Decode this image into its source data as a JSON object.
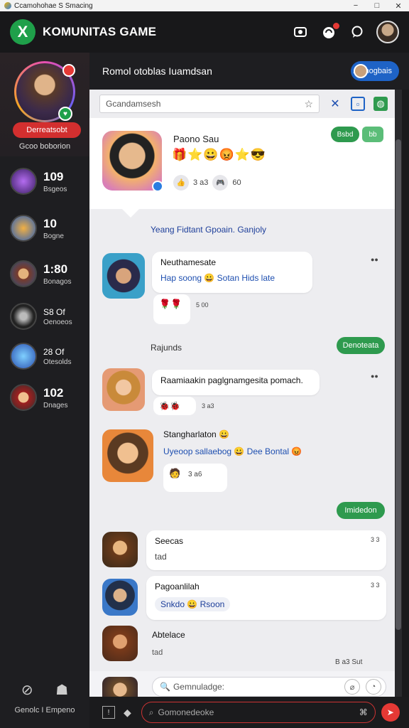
{
  "window": {
    "title": "Ccamohohae  S  Smacing",
    "min": "−",
    "max": "□",
    "close": "✕"
  },
  "header": {
    "logo_glyph": "X",
    "app_title": "KOMUNITAS GAME",
    "icons": [
      "screen-record-icon",
      "notification-icon",
      "chat-icon"
    ]
  },
  "sidebar": {
    "profile_tag": "Derreatsobt",
    "profile_sub": "Gcoo boborion",
    "stats": [
      {
        "value": "109",
        "label": "Bsgeos",
        "icon": "purple-sword-icon"
      },
      {
        "value": "10",
        "label": "Bogne",
        "icon": "blue-orange-sword-icon"
      },
      {
        "value": "1:80",
        "label": "Bonagos",
        "icon": "hero-portrait-icon"
      },
      {
        "value": "S8 Of",
        "label": "Oenoeos",
        "icon": "dark-mask-icon"
      },
      {
        "value": "28 Of",
        "label": "Otesolds",
        "icon": "blue-sword-icon"
      },
      {
        "value": "102",
        "label": "Dnages",
        "icon": "hero-portrait-icon"
      }
    ],
    "bottom_label": "Genolc I Empeno"
  },
  "main": {
    "title": "Romol otoblas Iuamdsan",
    "user_pill": "Alenogbais",
    "search_placeholder": "Gcandamsesh"
  },
  "featured": {
    "name": "Paono Sau",
    "emoji": "🎁⭐😀😡⭐😎",
    "meta_a": "3 a3",
    "meta_b": "60",
    "btn1": "Bsbd",
    "btn2": "bb"
  },
  "announcement": "Yeang Fidtant Gpoain. Ganjoly",
  "messages": [
    {
      "name": "Neuthamesate",
      "text": "Hap soong 😀 Sotan Hids late",
      "mini": "5 00",
      "time": ""
    },
    {
      "text": "Raamiaakin paglgnamgesita pomach.",
      "mini": "3 a3",
      "time": ""
    },
    {
      "name": "Stangharlaton 😀",
      "text": "Uyeoop sallaebog 😀 Dee Bontal 😡",
      "mini": "3 a6",
      "time": ""
    },
    {
      "name": "Seecas",
      "sub": "tad",
      "time": "3 3"
    },
    {
      "name": "Pagoanlilah",
      "row": "Snkdo 😀 Rsoon",
      "time": "3 3"
    },
    {
      "name": "Abtelace",
      "sub": "tad",
      "time": ""
    }
  ],
  "labels": {
    "raunds": "Rajunds",
    "green1": "Denoteata",
    "green2": "Imidedon",
    "footer_time": "B a3 Sut"
  },
  "composer": {
    "placeholder": "Gemnuladge:"
  },
  "bottom_field": {
    "placeholder": "Gomonedeoke"
  }
}
